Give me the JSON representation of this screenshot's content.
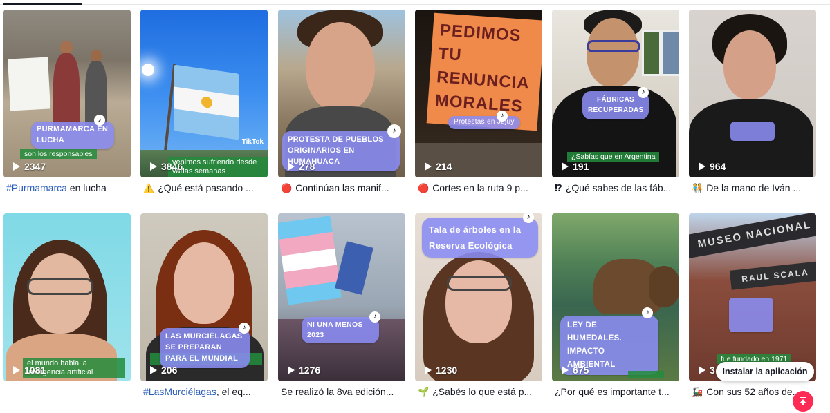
{
  "videos": [
    {
      "views": "2347",
      "caption_tag": "#Purmamarca",
      "caption_text": " en lucha",
      "emoji": "",
      "pill": "PURMAMARCA EN LUCHA",
      "green": "son los responsables"
    },
    {
      "views": "3846",
      "caption_tag": "",
      "caption_text": "¿Qué está pasando ...",
      "emoji": "⚠️",
      "pill": "",
      "green": "venimos sufriendo desde varias semanas",
      "watermark": "TikTok"
    },
    {
      "views": "278",
      "caption_tag": "",
      "caption_text": "Continúan las manif...",
      "emoji": "🔴",
      "pill": "PROTESTA DE PUEBLOS ORIGINARIOS EN HUMAHUACA",
      "green": ""
    },
    {
      "views": "214",
      "caption_tag": "",
      "caption_text": "Cortes en la ruta 9 p...",
      "emoji": "🔴",
      "pill": "Protestas en Jujuy",
      "sign": "PEDIMOS TU RENUNCIA MORALES",
      "green": ""
    },
    {
      "views": "191",
      "caption_tag": "",
      "caption_text": "¿Qué sabes de las fáb...",
      "emoji": "⁉",
      "pill": "FÁBRICAS RECUPERADAS",
      "green": "¿Sabías que en Argentina"
    },
    {
      "views": "964",
      "caption_tag": "",
      "caption_text": "De la mano de Iván ...",
      "emoji": "🧑‍🤝‍🧑",
      "pill": "",
      "green": ""
    },
    {
      "views": "1081",
      "caption_tag": "",
      "caption_text": "",
      "emoji": "",
      "pill": "",
      "green": "el mundo habla la inteligencia artificial"
    },
    {
      "views": "206",
      "caption_tag": "#LasMurciélagas",
      "caption_text": ", el eq...",
      "emoji": "",
      "pill": "LAS MURCIÉLAGAS SE PREPARAN PARA EL MUNDIAL",
      "green": ""
    },
    {
      "views": "1276",
      "caption_tag": "",
      "caption_text": "Se realizó la 8va edición...",
      "emoji": "",
      "pill": "NI UNA MENOS 2023",
      "green": ""
    },
    {
      "views": "1230",
      "caption_tag": "",
      "caption_text": "¿Sabés lo que está p...",
      "emoji": "🌱",
      "pill": "Tala de árboles en la Reserva Ecológica",
      "green": ""
    },
    {
      "views": "675",
      "caption_tag": "",
      "caption_text": "¿Por qué es importante t...",
      "emoji": "",
      "pill": "LEY DE HUMEDALES. IMPACTO AMBIENTAL",
      "green": ""
    },
    {
      "views": "3",
      "caption_tag": "",
      "caption_text": "Con sus 52 años de...",
      "emoji": "🚂",
      "pill": "",
      "sign": "MUSEO NACIONAL",
      "sign2": "RAUL SCALA",
      "green": "fue fundado en 1971"
    }
  ],
  "install_button": "Instalar la aplicación"
}
